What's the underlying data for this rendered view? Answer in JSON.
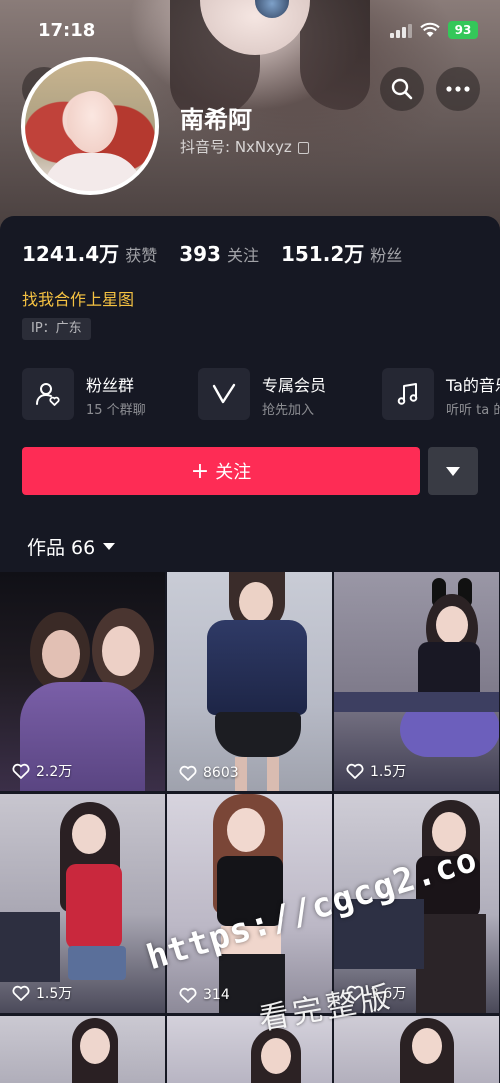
{
  "status_bar": {
    "time": "17:18",
    "battery": "93"
  },
  "profile": {
    "name": "南希阿",
    "douyin_id": "抖音号: NxNxyz",
    "stats": [
      {
        "value": "1241.4万",
        "label": "获赞"
      },
      {
        "value": "393",
        "label": "关注"
      },
      {
        "value": "151.2万",
        "label": "粉丝"
      }
    ],
    "bio": "找我合作上星图",
    "ip_location": "IP：广东"
  },
  "features": [
    {
      "title": "粉丝群",
      "subtitle": "15 个群聊",
      "icon": "fan-group-icon"
    },
    {
      "title": "专属会员",
      "subtitle": "抢先加入",
      "icon": "membership-v-icon"
    },
    {
      "title": "Ta的音乐",
      "subtitle": "听听 ta 的",
      "icon": "music-note-icon"
    }
  ],
  "actions": {
    "follow_label": "关注",
    "follow_plus": "+"
  },
  "works_tab": {
    "label": "作品 66"
  },
  "videos": [
    {
      "likes": "2.2万"
    },
    {
      "likes": "8603"
    },
    {
      "likes": "1.5万"
    },
    {
      "likes": "1.5万"
    },
    {
      "likes": "314"
    },
    {
      "likes": "3.6万"
    }
  ],
  "watermark": {
    "url": "https://cgcg2.co",
    "text": "看完整版"
  },
  "colors": {
    "accent": "#fe2c55",
    "background": "#161823",
    "bio": "#f5c242"
  }
}
